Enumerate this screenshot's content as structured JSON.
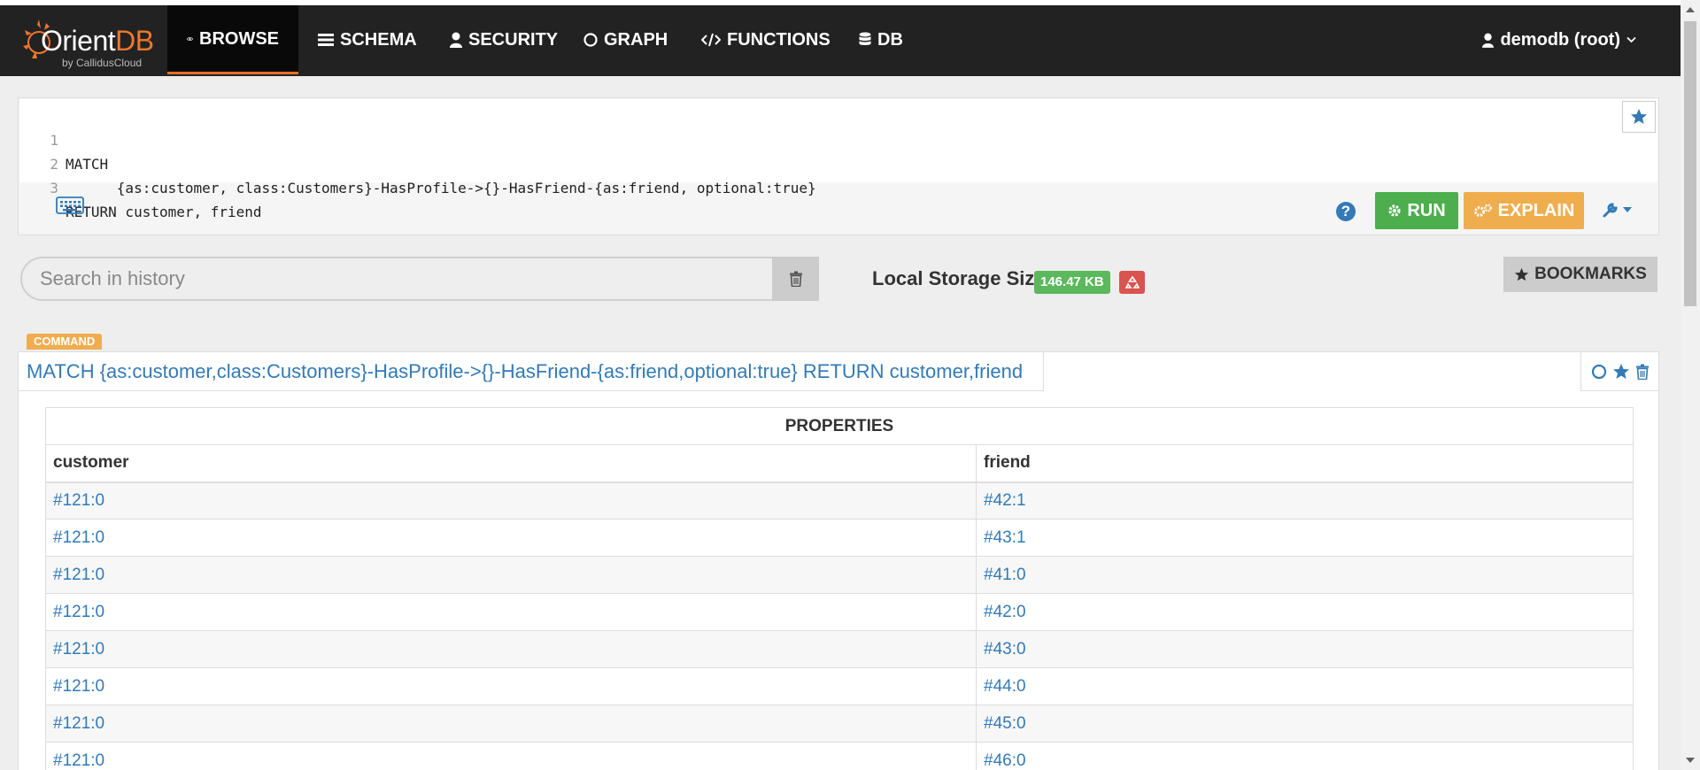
{
  "brand": {
    "name_main": "Orient",
    "name_accent": "DB",
    "sub": "by CallidusCloud"
  },
  "nav": {
    "items": [
      {
        "label": "BROWSE",
        "icon": "eye-icon",
        "active": true
      },
      {
        "label": "SCHEMA",
        "icon": "list-icon",
        "active": false
      },
      {
        "label": "SECURITY",
        "icon": "user-icon",
        "active": false
      },
      {
        "label": "GRAPH",
        "icon": "circle-icon",
        "active": false
      },
      {
        "label": "FUNCTIONS",
        "icon": "code-icon",
        "active": false
      },
      {
        "label": "DB",
        "icon": "database-icon",
        "active": false
      }
    ],
    "user": "demodb (root)"
  },
  "editor": {
    "lines": [
      {
        "num": "1",
        "text": "MATCH"
      },
      {
        "num": "2",
        "text": "      {as:customer, class:Customers}-HasProfile->{}-HasFriend-{as:friend, optional:true}"
      },
      {
        "num": "3",
        "text": "RETURN customer, friend"
      }
    ],
    "run_label": "RUN",
    "explain_label": "EXPLAIN"
  },
  "history": {
    "search_placeholder": "Search in history",
    "storage_label": "Local Storage Size",
    "storage_size": "146.47 KB",
    "bookmarks_label": "BOOKMARKS"
  },
  "result": {
    "badge": "COMMAND",
    "query": "MATCH {as:customer,class:Customers}-HasProfile->{}-HasFriend-{as:friend,optional:true} RETURN customer,friend",
    "table_title": "PROPERTIES",
    "columns": [
      "customer",
      "friend"
    ],
    "rows": [
      [
        "#121:0",
        "#42:1"
      ],
      [
        "#121:0",
        "#43:1"
      ],
      [
        "#121:0",
        "#41:0"
      ],
      [
        "#121:0",
        "#42:0"
      ],
      [
        "#121:0",
        "#43:0"
      ],
      [
        "#121:0",
        "#44:0"
      ],
      [
        "#121:0",
        "#45:0"
      ],
      [
        "#121:0",
        "#46:0"
      ]
    ]
  },
  "colors": {
    "navbar": "#222222",
    "active_underline": "#e8702a",
    "run": "#4cae4c",
    "explain": "#f0ad4e",
    "link": "#337ab7",
    "storage_badge": "#5cb85c",
    "danger": "#d9534f"
  }
}
